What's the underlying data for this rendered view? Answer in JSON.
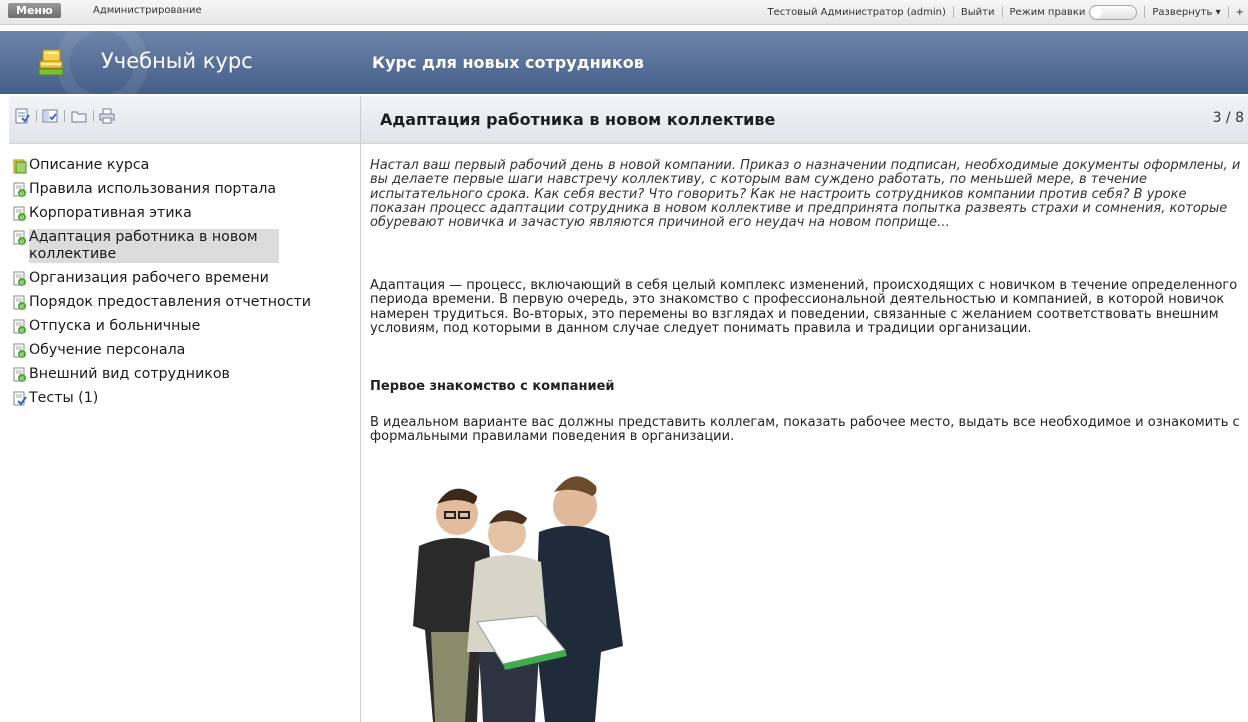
{
  "topbar": {
    "menu": "Меню",
    "admin": "Администрирование",
    "user": "Тестовый Администратор (admin)",
    "logout": "Выйти",
    "edit_mode": "Режим правки",
    "expand": "Развернуть ▾",
    "extra": "+"
  },
  "header": {
    "site_title": "Учебный курс",
    "course_title": "Курс для новых сотрудников"
  },
  "toolbar_icons": [
    "lesson-view-icon",
    "split-view-icon",
    "folder-icon",
    "print-icon"
  ],
  "nav": {
    "items": [
      {
        "label": "Описание курса",
        "icon": "course-icon"
      },
      {
        "label": "Правила использования портала",
        "icon": "lesson-icon"
      },
      {
        "label": "Корпоративная этика",
        "icon": "lesson-icon"
      },
      {
        "label": "Адаптация работника в новом коллективе",
        "icon": "lesson-icon",
        "active": true
      },
      {
        "label": "Организация рабочего времени",
        "icon": "lesson-icon"
      },
      {
        "label": "Порядок предоставления отчетности",
        "icon": "lesson-icon"
      },
      {
        "label": "Отпуска и больничные",
        "icon": "lesson-icon"
      },
      {
        "label": "Обучение персонала",
        "icon": "lesson-icon"
      },
      {
        "label": "Внешний вид сотрудников",
        "icon": "lesson-icon"
      },
      {
        "label": "Тесты (1)",
        "icon": "test-icon"
      }
    ]
  },
  "content": {
    "title": "Адаптация работника в новом коллективе",
    "page": "3 / 8",
    "intro": "Настал ваш первый рабочий день в новой компании. Приказ о назначении подписан, необходимые документы оформлены, и вы делаете первые шаги навстречу коллективу, с которым вам суждено работать, по меньшей мере, в течение испытательного срока. Как себя вести? Что говорить? Как не настроить сотрудников компании против себя? В уроке показан процесс адаптации сотрудника в новом коллективе и предпринята попытка развеять страхи и сомнения, которые обуревают новичка и зачастую являются причиной его неудач на новом поприще…",
    "paragraph1": "Адаптация — процесс, включающий в себя целый комплекс изменений, происходящих с новичком в течение определенного периода времени. В первую очередь, это знакомство с профессиональной деятельностью и компанией, в которой новичок намерен трудиться. Во-вторых, это перемены во взглядах и поведении, связанные с желанием соответствовать внешним условиям, под которыми в данном случае следует понимать правила и традиции организации.",
    "subheading": "Первое знакомство с компанией",
    "paragraph2": "В идеальном варианте вас должны представить коллегам, показать рабочее место, выдать все необходимое и ознакомить с формальными правилами поведения в организации."
  }
}
